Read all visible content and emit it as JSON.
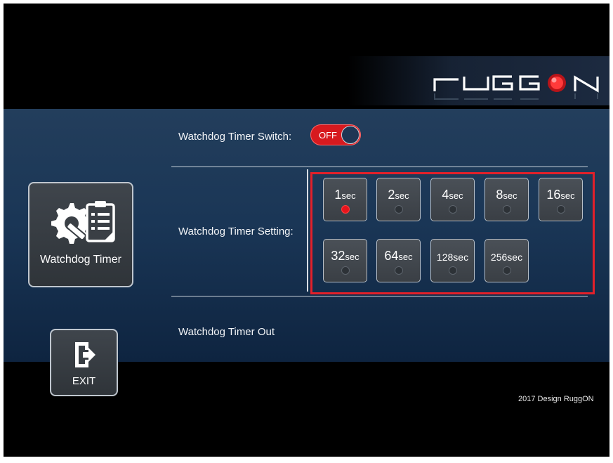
{
  "brand": {
    "logo_text": "RUGGON",
    "accent": "#e3202a"
  },
  "switch": {
    "label": "Watchdog Timer Switch:",
    "state": "OFF"
  },
  "setting": {
    "label": "Watchdog Timer Setting:",
    "selected": "1sec",
    "options": [
      {
        "num": "1",
        "unit": "sec",
        "selected": true
      },
      {
        "num": "2",
        "unit": "sec",
        "selected": false
      },
      {
        "num": "4",
        "unit": "sec",
        "selected": false
      },
      {
        "num": "8",
        "unit": "sec",
        "selected": false
      },
      {
        "num": "16",
        "unit": "sec",
        "selected": false
      },
      {
        "num": "32",
        "unit": "sec",
        "selected": false
      },
      {
        "num": "64",
        "unit": "sec",
        "selected": false
      },
      {
        "num": "128",
        "unit": "sec",
        "selected": false
      },
      {
        "num": "256",
        "unit": "sec",
        "selected": false
      }
    ]
  },
  "timer_out": {
    "label": "Watchdog Timer Out"
  },
  "sidebar": {
    "watchdog_label": "Watchdog Timer",
    "watchdog_icon": "gear-wrench-clipboard-icon",
    "exit_label": "EXIT",
    "exit_icon": "exit-door-arrow-icon"
  },
  "footer": {
    "copyright": "2017 Design RuggON"
  }
}
